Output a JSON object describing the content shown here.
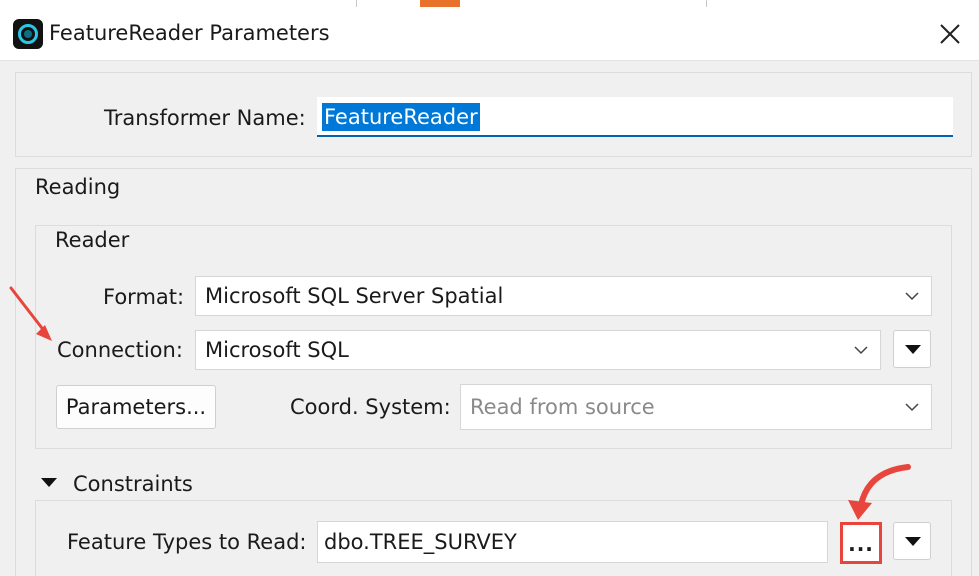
{
  "dialog": {
    "title": "FeatureReader Parameters",
    "close_glyph": "✕"
  },
  "transformer": {
    "label": "Transformer Name:",
    "value": "FeatureReader"
  },
  "reading": {
    "group_label": "Reading",
    "reader": {
      "group_label": "Reader",
      "format_label": "Format:",
      "format_value": "Microsoft SQL Server Spatial",
      "connection_label": "Connection:",
      "connection_value": "Microsoft SQL",
      "parameters_button": "Parameters...",
      "coord_label": "Coord. System:",
      "coord_placeholder": "Read from source"
    },
    "constraints": {
      "group_label": "Constraints",
      "feature_types_label": "Feature Types to Read:",
      "feature_types_value": "dbo.TREE_SURVEY",
      "browse_label": "..."
    }
  },
  "colors": {
    "accent": "#0078d7",
    "annotation_red": "#e8453c",
    "app_icon_ring": "#2dc6e6"
  },
  "icons": [
    "app-icon",
    "close-icon",
    "chevron-down-icon",
    "dropdown-triangle-icon",
    "expand-triangle-icon",
    "annotation-arrow-icon"
  ]
}
